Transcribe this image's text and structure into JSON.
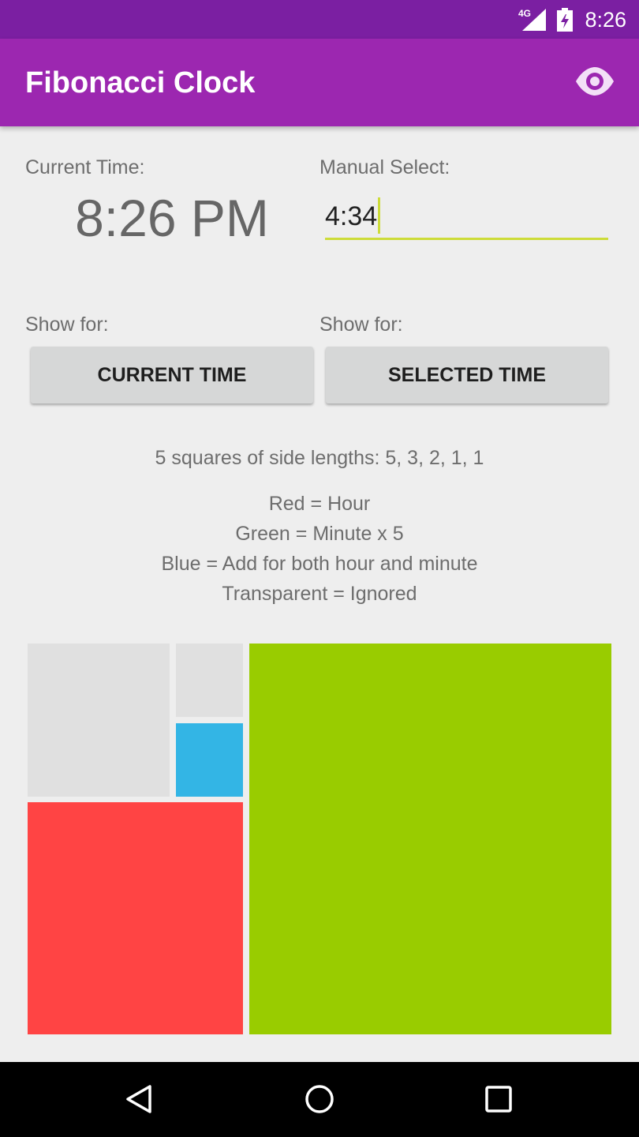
{
  "status_bar": {
    "network": "4G",
    "time": "8:26",
    "icons": [
      "signal-icon",
      "battery-icon"
    ]
  },
  "app_bar": {
    "title": "Fibonacci Clock",
    "action_icon": "eye-icon"
  },
  "current_time": {
    "label": "Current Time:",
    "value": "8:26 PM"
  },
  "manual_select": {
    "label": "Manual Select:",
    "value": "4:34"
  },
  "show_for": {
    "left_label": "Show for:",
    "right_label": "Show for:",
    "current_button": "CURRENT TIME",
    "selected_button": "SELECTED TIME"
  },
  "info": {
    "squares": "5 squares of side lengths: 5, 3, 2, 1, 1",
    "legend": [
      "Red = Hour",
      "Green = Minute x 5",
      "Blue = Add for both hour and minute",
      "Transparent = Ignored"
    ]
  },
  "squares": [
    {
      "name": "square-side-2",
      "side": 2,
      "state": "transparent"
    },
    {
      "name": "square-side-1-top",
      "side": 1,
      "state": "transparent"
    },
    {
      "name": "square-side-1-bottom",
      "side": 1,
      "state": "blue"
    },
    {
      "name": "square-side-3",
      "side": 3,
      "state": "red"
    },
    {
      "name": "square-side-5",
      "side": 5,
      "state": "green"
    }
  ],
  "colors": {
    "status_bar": "#7b1fa2",
    "app_bar": "#9c27b0",
    "accent": "#cddc39",
    "red": "#ff4444",
    "green": "#99cc00",
    "blue": "#33b5e5",
    "transparent": "#e0e0e0"
  },
  "nav_bar": {
    "icons": [
      "back-icon",
      "home-icon",
      "recents-icon"
    ]
  }
}
